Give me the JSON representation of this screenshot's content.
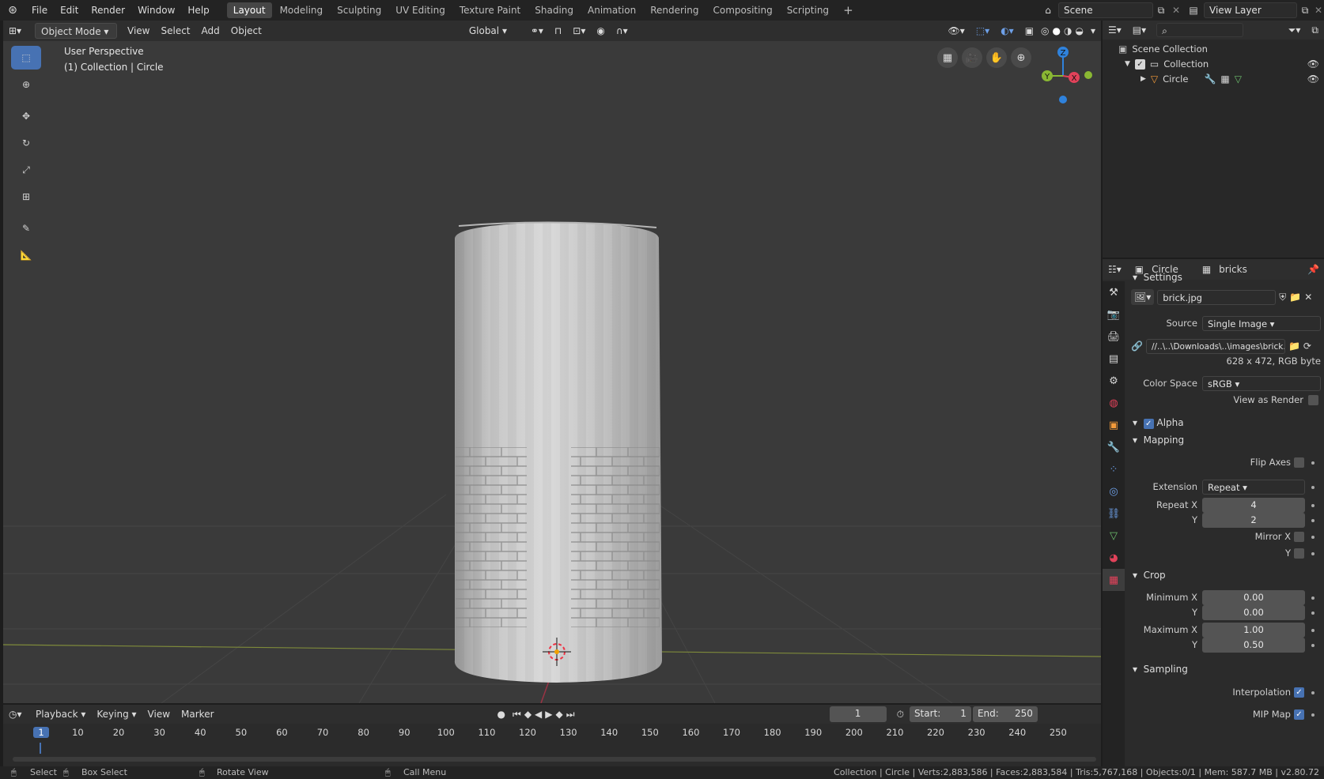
{
  "topbar": {
    "menus": [
      "File",
      "Edit",
      "Render",
      "Window",
      "Help"
    ],
    "workspaces": [
      "Layout",
      "Modeling",
      "Sculpting",
      "UV Editing",
      "Texture Paint",
      "Shading",
      "Animation",
      "Rendering",
      "Compositing",
      "Scripting"
    ],
    "active_workspace": "Layout",
    "scene": "Scene",
    "view_layer": "View Layer"
  },
  "viewport": {
    "mode": "Object Mode",
    "menus": [
      "View",
      "Select",
      "Add",
      "Object"
    ],
    "orientation": "Global",
    "overlay_title": "User Perspective",
    "overlay_subtitle": "(1) Collection | Circle",
    "gizmo": {
      "z": "Z",
      "x": "X",
      "y": "Y"
    }
  },
  "timeline": {
    "menus": [
      "Playback",
      "Keying",
      "View",
      "Marker"
    ],
    "current_frame": "1",
    "start_label": "Start:",
    "start": "1",
    "end_label": "End:",
    "end": "250",
    "ruler": [
      "1",
      "10",
      "20",
      "30",
      "40",
      "50",
      "60",
      "70",
      "80",
      "90",
      "100",
      "110",
      "120",
      "130",
      "140",
      "150",
      "160",
      "170",
      "180",
      "190",
      "200",
      "210",
      "220",
      "230",
      "240",
      "250"
    ]
  },
  "outliner": {
    "scene_collection": "Scene Collection",
    "collection": "Collection",
    "object": "Circle"
  },
  "properties": {
    "breadcrumb_object": "Circle",
    "breadcrumb_texture": "bricks",
    "settings_label": "Settings",
    "image_name": "brick.jpg",
    "source_label": "Source",
    "source": "Single Image",
    "filepath": "//..\\..\\Downloads\\..\\images\\brick.jpg",
    "image_info": "628 x 472,  RGB byte",
    "color_space_label": "Color Space",
    "color_space": "sRGB",
    "view_as_render": "View as Render",
    "alpha": "Alpha",
    "mapping": "Mapping",
    "flip_axes": "Flip Axes",
    "extension_label": "Extension",
    "extension": "Repeat",
    "repeat_x_label": "Repeat X",
    "repeat_x": "4",
    "y_label": "Y",
    "repeat_y": "2",
    "mirror_x": "Mirror X",
    "crop": "Crop",
    "min_x_label": "Minimum X",
    "min_x": "0.00",
    "min_y": "0.00",
    "max_x_label": "Maximum X",
    "max_x": "1.00",
    "max_y": "0.50",
    "sampling": "Sampling",
    "interpolation": "Interpolation",
    "mip_map": "MIP Map"
  },
  "statusbar": {
    "select": "Select",
    "box_select": "Box Select",
    "rotate_view": "Rotate View",
    "call_menu": "Call Menu",
    "stats": "Collection | Circle | Verts:2,883,586 | Faces:2,883,584 | Tris:5,767,168 | Objects:0/1 | Mem: 587.7 MB | v2.80.72"
  },
  "colors": {
    "accent": "#4772b3",
    "x_axis": "#e2425a",
    "y_axis": "#8ab833",
    "z_axis": "#2f82dc"
  }
}
